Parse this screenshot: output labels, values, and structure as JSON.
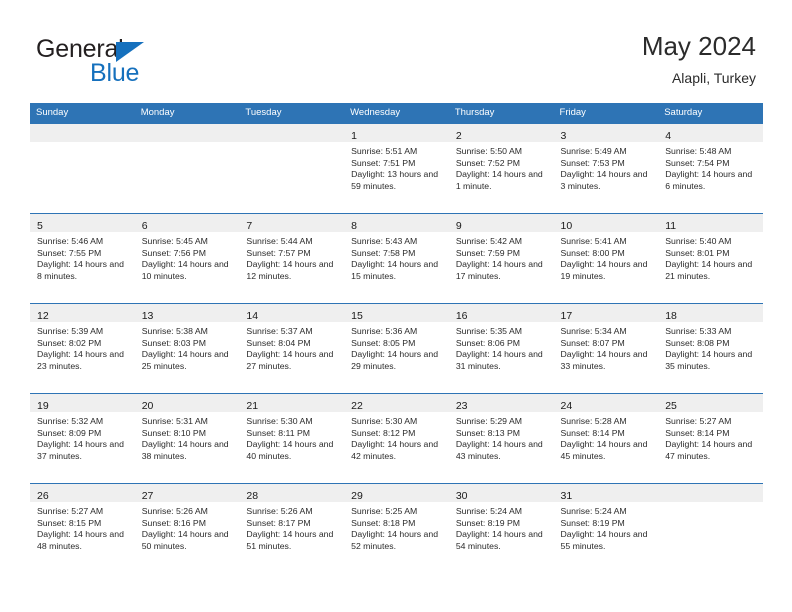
{
  "brand": {
    "word_one": "General",
    "word_two": "Blue",
    "triangle_color": "#1570bd",
    "icon": "brand-triangle-icon"
  },
  "header": {
    "title": "May 2024",
    "location": "Alapli, Turkey"
  },
  "theme": {
    "header_blue": "#2e74b5",
    "daynum_band": "#efefef",
    "brand_blue": "#1570bd"
  },
  "calendar": {
    "weekday_headers": [
      "Sunday",
      "Monday",
      "Tuesday",
      "Wednesday",
      "Thursday",
      "Friday",
      "Saturday"
    ],
    "weeks": [
      [
        {
          "day": "",
          "blank": true
        },
        {
          "day": "",
          "blank": true
        },
        {
          "day": "",
          "blank": true
        },
        {
          "day": "1",
          "sunrise": "Sunrise: 5:51 AM",
          "sunset": "Sunset: 7:51 PM",
          "daylight": "Daylight: 13 hours and 59 minutes."
        },
        {
          "day": "2",
          "sunrise": "Sunrise: 5:50 AM",
          "sunset": "Sunset: 7:52 PM",
          "daylight": "Daylight: 14 hours and 1 minute."
        },
        {
          "day": "3",
          "sunrise": "Sunrise: 5:49 AM",
          "sunset": "Sunset: 7:53 PM",
          "daylight": "Daylight: 14 hours and 3 minutes."
        },
        {
          "day": "4",
          "sunrise": "Sunrise: 5:48 AM",
          "sunset": "Sunset: 7:54 PM",
          "daylight": "Daylight: 14 hours and 6 minutes."
        }
      ],
      [
        {
          "day": "5",
          "sunrise": "Sunrise: 5:46 AM",
          "sunset": "Sunset: 7:55 PM",
          "daylight": "Daylight: 14 hours and 8 minutes."
        },
        {
          "day": "6",
          "sunrise": "Sunrise: 5:45 AM",
          "sunset": "Sunset: 7:56 PM",
          "daylight": "Daylight: 14 hours and 10 minutes."
        },
        {
          "day": "7",
          "sunrise": "Sunrise: 5:44 AM",
          "sunset": "Sunset: 7:57 PM",
          "daylight": "Daylight: 14 hours and 12 minutes."
        },
        {
          "day": "8",
          "sunrise": "Sunrise: 5:43 AM",
          "sunset": "Sunset: 7:58 PM",
          "daylight": "Daylight: 14 hours and 15 minutes."
        },
        {
          "day": "9",
          "sunrise": "Sunrise: 5:42 AM",
          "sunset": "Sunset: 7:59 PM",
          "daylight": "Daylight: 14 hours and 17 minutes."
        },
        {
          "day": "10",
          "sunrise": "Sunrise: 5:41 AM",
          "sunset": "Sunset: 8:00 PM",
          "daylight": "Daylight: 14 hours and 19 minutes."
        },
        {
          "day": "11",
          "sunrise": "Sunrise: 5:40 AM",
          "sunset": "Sunset: 8:01 PM",
          "daylight": "Daylight: 14 hours and 21 minutes."
        }
      ],
      [
        {
          "day": "12",
          "sunrise": "Sunrise: 5:39 AM",
          "sunset": "Sunset: 8:02 PM",
          "daylight": "Daylight: 14 hours and 23 minutes."
        },
        {
          "day": "13",
          "sunrise": "Sunrise: 5:38 AM",
          "sunset": "Sunset: 8:03 PM",
          "daylight": "Daylight: 14 hours and 25 minutes."
        },
        {
          "day": "14",
          "sunrise": "Sunrise: 5:37 AM",
          "sunset": "Sunset: 8:04 PM",
          "daylight": "Daylight: 14 hours and 27 minutes."
        },
        {
          "day": "15",
          "sunrise": "Sunrise: 5:36 AM",
          "sunset": "Sunset: 8:05 PM",
          "daylight": "Daylight: 14 hours and 29 minutes."
        },
        {
          "day": "16",
          "sunrise": "Sunrise: 5:35 AM",
          "sunset": "Sunset: 8:06 PM",
          "daylight": "Daylight: 14 hours and 31 minutes."
        },
        {
          "day": "17",
          "sunrise": "Sunrise: 5:34 AM",
          "sunset": "Sunset: 8:07 PM",
          "daylight": "Daylight: 14 hours and 33 minutes."
        },
        {
          "day": "18",
          "sunrise": "Sunrise: 5:33 AM",
          "sunset": "Sunset: 8:08 PM",
          "daylight": "Daylight: 14 hours and 35 minutes."
        }
      ],
      [
        {
          "day": "19",
          "sunrise": "Sunrise: 5:32 AM",
          "sunset": "Sunset: 8:09 PM",
          "daylight": "Daylight: 14 hours and 37 minutes."
        },
        {
          "day": "20",
          "sunrise": "Sunrise: 5:31 AM",
          "sunset": "Sunset: 8:10 PM",
          "daylight": "Daylight: 14 hours and 38 minutes."
        },
        {
          "day": "21",
          "sunrise": "Sunrise: 5:30 AM",
          "sunset": "Sunset: 8:11 PM",
          "daylight": "Daylight: 14 hours and 40 minutes."
        },
        {
          "day": "22",
          "sunrise": "Sunrise: 5:30 AM",
          "sunset": "Sunset: 8:12 PM",
          "daylight": "Daylight: 14 hours and 42 minutes."
        },
        {
          "day": "23",
          "sunrise": "Sunrise: 5:29 AM",
          "sunset": "Sunset: 8:13 PM",
          "daylight": "Daylight: 14 hours and 43 minutes."
        },
        {
          "day": "24",
          "sunrise": "Sunrise: 5:28 AM",
          "sunset": "Sunset: 8:14 PM",
          "daylight": "Daylight: 14 hours and 45 minutes."
        },
        {
          "day": "25",
          "sunrise": "Sunrise: 5:27 AM",
          "sunset": "Sunset: 8:14 PM",
          "daylight": "Daylight: 14 hours and 47 minutes."
        }
      ],
      [
        {
          "day": "26",
          "sunrise": "Sunrise: 5:27 AM",
          "sunset": "Sunset: 8:15 PM",
          "daylight": "Daylight: 14 hours and 48 minutes."
        },
        {
          "day": "27",
          "sunrise": "Sunrise: 5:26 AM",
          "sunset": "Sunset: 8:16 PM",
          "daylight": "Daylight: 14 hours and 50 minutes."
        },
        {
          "day": "28",
          "sunrise": "Sunrise: 5:26 AM",
          "sunset": "Sunset: 8:17 PM",
          "daylight": "Daylight: 14 hours and 51 minutes."
        },
        {
          "day": "29",
          "sunrise": "Sunrise: 5:25 AM",
          "sunset": "Sunset: 8:18 PM",
          "daylight": "Daylight: 14 hours and 52 minutes."
        },
        {
          "day": "30",
          "sunrise": "Sunrise: 5:24 AM",
          "sunset": "Sunset: 8:19 PM",
          "daylight": "Daylight: 14 hours and 54 minutes."
        },
        {
          "day": "31",
          "sunrise": "Sunrise: 5:24 AM",
          "sunset": "Sunset: 8:19 PM",
          "daylight": "Daylight: 14 hours and 55 minutes."
        },
        {
          "day": "",
          "blank": true
        }
      ]
    ]
  }
}
